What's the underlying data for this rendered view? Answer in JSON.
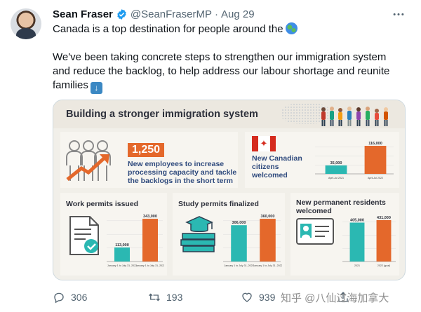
{
  "tweet": {
    "author_name": "Sean Fraser",
    "handle": "@SeanFraserMP",
    "separator": "·",
    "date": "Aug 29",
    "line1": "Canada is a top destination for people around the",
    "line2": "We've been taking concrete steps to strengthen our immigration system",
    "line3": "and reduce the backlog, to help address our labour shortage and reunite",
    "line4": "families"
  },
  "infographic": {
    "title": "Building a stronger immigration system",
    "employees": {
      "number": "1,250",
      "text": "New employees to increase processing capacity and tackle the backlogs in the short term"
    },
    "citizens": {
      "text": "New Canadian citizens welcomed"
    },
    "panels": {
      "work": "Work permits issued",
      "study": "Study permits finalized",
      "residents": "New permanent residents welcomed"
    }
  },
  "chart_data": [
    {
      "type": "bar",
      "title": "New Canadian citizens welcomed",
      "categories": [
        "April-Jul 2021",
        "April-Jul 2022"
      ],
      "values": [
        35000,
        116000
      ],
      "value_labels": [
        "35,000",
        "116,000"
      ],
      "colors": [
        "#2bb8b2",
        "#e4682b"
      ]
    },
    {
      "type": "bar",
      "title": "Work permits issued",
      "categories": [
        "January 1 to July 31, 2021",
        "January 1 to July 31, 2022"
      ],
      "values": [
        113000,
        343000
      ],
      "value_labels": [
        "113,000",
        "343,000"
      ],
      "colors": [
        "#2bb8b2",
        "#e4682b"
      ]
    },
    {
      "type": "bar",
      "title": "Study permits finalized",
      "categories": [
        "January 1 to July 31, 2021",
        "January 1 to July 31, 2022"
      ],
      "values": [
        306000,
        360000
      ],
      "value_labels": [
        "306,000",
        "360,000"
      ],
      "colors": [
        "#2bb8b2",
        "#e4682b"
      ]
    },
    {
      "type": "bar",
      "title": "New permanent residents welcomed",
      "categories": [
        "2021",
        "2022 (goal)"
      ],
      "values": [
        405000,
        431000
      ],
      "value_labels": [
        "405,000",
        "431,000"
      ],
      "colors": [
        "#2bb8b2",
        "#e4682b"
      ]
    }
  ],
  "actions": {
    "replies": "306",
    "retweets": "193",
    "likes": "939"
  },
  "watermark": "知乎 @八仙过海加拿大",
  "colors": {
    "accent_teal": "#2bb8b2",
    "accent_orange": "#e4682b",
    "text_navy": "#2f4a7d",
    "verified_blue": "#1d9bf0",
    "meta_gray": "#536471"
  }
}
